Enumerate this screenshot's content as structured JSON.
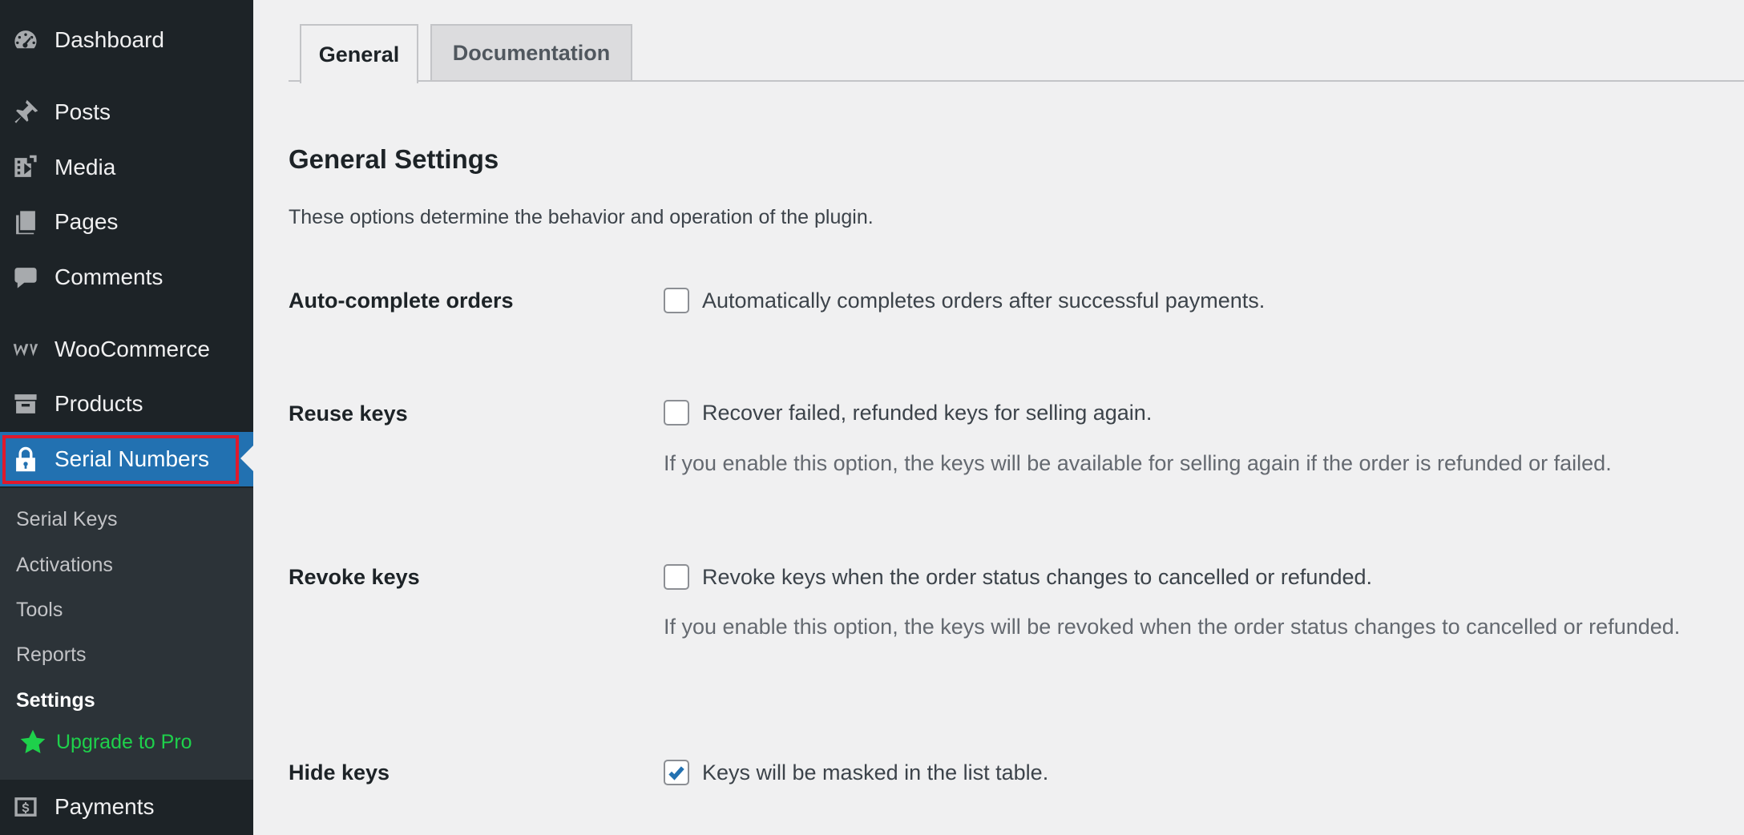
{
  "sidebar": {
    "menu": [
      {
        "label": "Dashboard",
        "icon": "dashboard-icon"
      },
      {
        "label": "Posts",
        "icon": "pin-icon"
      },
      {
        "label": "Media",
        "icon": "media-icon"
      },
      {
        "label": "Pages",
        "icon": "pages-icon"
      },
      {
        "label": "Comments",
        "icon": "comment-icon"
      },
      {
        "label": "WooCommerce",
        "icon": "woocommerce-icon"
      },
      {
        "label": "Products",
        "icon": "archive-icon"
      },
      {
        "label": "Serial Numbers",
        "icon": "lock-icon"
      }
    ],
    "submenu": [
      "Serial Keys",
      "Activations",
      "Tools",
      "Reports",
      "Settings",
      "Upgrade to Pro"
    ],
    "payments": {
      "label": "Payments",
      "icon": "payments-icon"
    },
    "active_color": "#2271b1",
    "highlight_color": "#e0192c",
    "pro_color": "#1ed14b"
  },
  "tabs": {
    "general": "General",
    "documentation": "Documentation"
  },
  "page": {
    "title": "General Settings",
    "description": "These options determine the behavior and operation of the plugin."
  },
  "settings": [
    {
      "label": "Auto-complete orders",
      "checkbox_label": "Automatically completes orders after successful payments.",
      "checked": false,
      "help": ""
    },
    {
      "label": "Reuse keys",
      "checkbox_label": "Recover failed, refunded keys for selling again.",
      "checked": false,
      "help": "If you enable this option, the keys will be available for selling again if the order is refunded or failed."
    },
    {
      "label": "Revoke keys",
      "checkbox_label": "Revoke keys when the order status changes to cancelled or refunded.",
      "checked": false,
      "help": "If you enable this option, the keys will be revoked when the order status changes to cancelled or refunded."
    },
    {
      "label": "Hide keys",
      "checkbox_label": "Keys will be masked in the list table.",
      "checked": true,
      "help": ""
    }
  ]
}
